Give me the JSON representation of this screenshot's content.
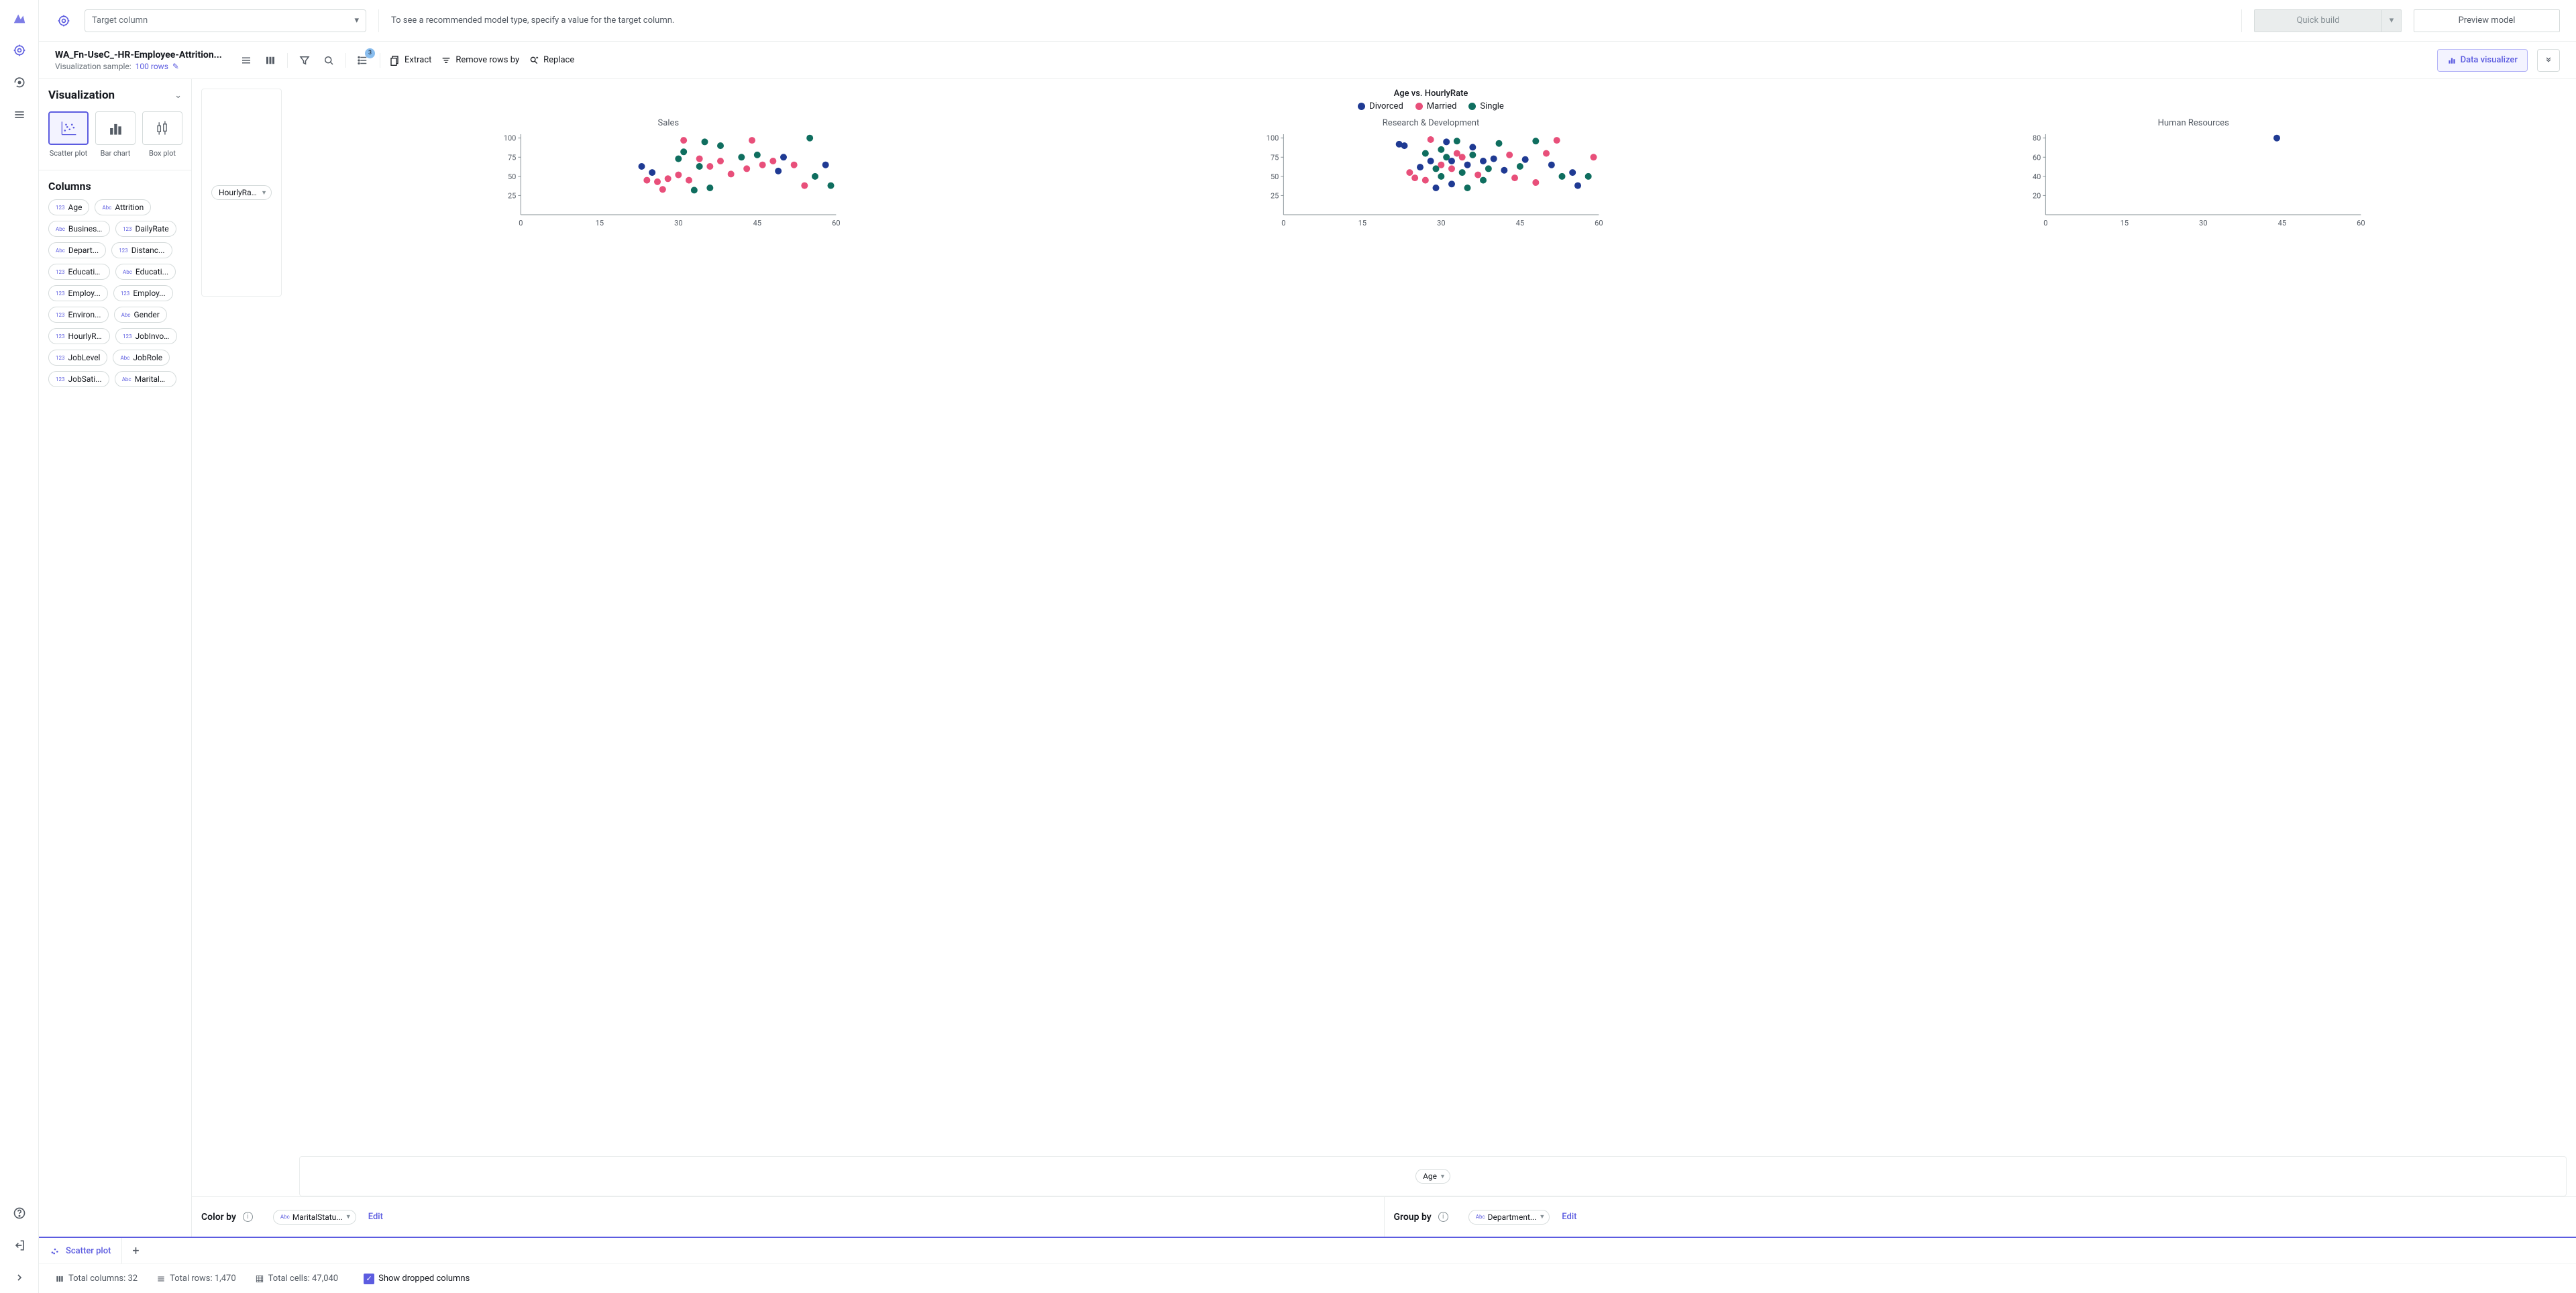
{
  "topbar": {
    "target_placeholder": "Target column",
    "hint": "To see a recommended model type, specify a value for the target column.",
    "quick_build": "Quick build",
    "preview_model": "Preview model"
  },
  "toolbar": {
    "file_title": "WA_Fn-UseC_-HR-Employee-Attrition...",
    "sample_label": "Visualization sample:",
    "sample_value": "100 rows",
    "badge": "3",
    "extract": "Extract",
    "remove_rows": "Remove rows by",
    "replace": "Replace",
    "data_visualizer": "Data visualizer"
  },
  "sidepanel": {
    "title": "Visualization",
    "viz_types": [
      {
        "label": "Scatter plot",
        "active": true
      },
      {
        "label": "Bar chart",
        "active": false
      },
      {
        "label": "Box plot",
        "active": false
      }
    ],
    "columns_title": "Columns",
    "columns": [
      {
        "type": "123",
        "name": "Age"
      },
      {
        "type": "Abc",
        "name": "Attrition"
      },
      {
        "type": "Abc",
        "name": "Busines..."
      },
      {
        "type": "123",
        "name": "DailyRate"
      },
      {
        "type": "Abc",
        "name": "Depart..."
      },
      {
        "type": "123",
        "name": "Distanc..."
      },
      {
        "type": "123",
        "name": "Education"
      },
      {
        "type": "Abc",
        "name": "Educati..."
      },
      {
        "type": "123",
        "name": "Employ..."
      },
      {
        "type": "123",
        "name": "Employ..."
      },
      {
        "type": "123",
        "name": "Environ..."
      },
      {
        "type": "Abc",
        "name": "Gender"
      },
      {
        "type": "123",
        "name": "HourlyR..."
      },
      {
        "type": "123",
        "name": "JobInvo..."
      },
      {
        "type": "123",
        "name": "JobLevel"
      },
      {
        "type": "Abc",
        "name": "JobRole"
      },
      {
        "type": "123",
        "name": "JobSati..."
      },
      {
        "type": "Abc",
        "name": "MaritalS..."
      }
    ]
  },
  "chart": {
    "title": "Age vs. HourlyRate",
    "legend": [
      {
        "name": "Divorced",
        "color": "#1f3a93"
      },
      {
        "name": "Married",
        "color": "#e84f7a"
      },
      {
        "name": "Single",
        "color": "#0f6e5f"
      }
    ],
    "y_pill": "HourlyRate...",
    "x_pill": "Age",
    "facets": [
      "Sales",
      "Research & Development",
      "Human Resources"
    ]
  },
  "chart_data": {
    "type": "scatter",
    "title": "Age vs. HourlyRate",
    "xlabel": "Age",
    "ylabel": "HourlyRate",
    "xlim": [
      0,
      60
    ],
    "ylim": [
      0,
      110
    ],
    "xticks": [
      0,
      15,
      30,
      45,
      60
    ],
    "yticks_main": [
      25,
      50,
      75,
      100
    ],
    "yticks_hr": [
      20,
      40,
      60,
      80
    ],
    "color_by": "MaritalStatus",
    "group_by": "Department",
    "colors": {
      "Divorced": "#1f3a93",
      "Married": "#e84f7a",
      "Single": "#0f6e5f"
    },
    "facets": {
      "Sales": [
        {
          "x": 23,
          "y": 63,
          "c": "Divorced"
        },
        {
          "x": 24,
          "y": 45,
          "c": "Married"
        },
        {
          "x": 25,
          "y": 55,
          "c": "Divorced"
        },
        {
          "x": 26,
          "y": 43,
          "c": "Married"
        },
        {
          "x": 27,
          "y": 33,
          "c": "Married"
        },
        {
          "x": 28,
          "y": 47,
          "c": "Married"
        },
        {
          "x": 30,
          "y": 73,
          "c": "Single"
        },
        {
          "x": 30,
          "y": 52,
          "c": "Married"
        },
        {
          "x": 31,
          "y": 97,
          "c": "Married"
        },
        {
          "x": 31,
          "y": 82,
          "c": "Single"
        },
        {
          "x": 32,
          "y": 45,
          "c": "Married"
        },
        {
          "x": 33,
          "y": 32,
          "c": "Single"
        },
        {
          "x": 34,
          "y": 73,
          "c": "Married"
        },
        {
          "x": 34,
          "y": 63,
          "c": "Single"
        },
        {
          "x": 35,
          "y": 95,
          "c": "Single"
        },
        {
          "x": 36,
          "y": 35,
          "c": "Single"
        },
        {
          "x": 36,
          "y": 63,
          "c": "Married"
        },
        {
          "x": 38,
          "y": 90,
          "c": "Single"
        },
        {
          "x": 38,
          "y": 70,
          "c": "Married"
        },
        {
          "x": 40,
          "y": 53,
          "c": "Married"
        },
        {
          "x": 42,
          "y": 75,
          "c": "Single"
        },
        {
          "x": 43,
          "y": 60,
          "c": "Married"
        },
        {
          "x": 44,
          "y": 97,
          "c": "Married"
        },
        {
          "x": 45,
          "y": 78,
          "c": "Single"
        },
        {
          "x": 46,
          "y": 65,
          "c": "Married"
        },
        {
          "x": 48,
          "y": 70,
          "c": "Married"
        },
        {
          "x": 49,
          "y": 57,
          "c": "Divorced"
        },
        {
          "x": 50,
          "y": 75,
          "c": "Divorced"
        },
        {
          "x": 52,
          "y": 65,
          "c": "Married"
        },
        {
          "x": 54,
          "y": 38,
          "c": "Married"
        },
        {
          "x": 55,
          "y": 100,
          "c": "Single"
        },
        {
          "x": 56,
          "y": 50,
          "c": "Single"
        },
        {
          "x": 58,
          "y": 65,
          "c": "Divorced"
        },
        {
          "x": 59,
          "y": 38,
          "c": "Single"
        }
      ],
      "Research & Development": [
        {
          "x": 22,
          "y": 92,
          "c": "Divorced"
        },
        {
          "x": 23,
          "y": 90,
          "c": "Divorced"
        },
        {
          "x": 24,
          "y": 55,
          "c": "Married"
        },
        {
          "x": 25,
          "y": 48,
          "c": "Married"
        },
        {
          "x": 26,
          "y": 62,
          "c": "Divorced"
        },
        {
          "x": 27,
          "y": 80,
          "c": "Single"
        },
        {
          "x": 27,
          "y": 45,
          "c": "Married"
        },
        {
          "x": 28,
          "y": 98,
          "c": "Married"
        },
        {
          "x": 28,
          "y": 70,
          "c": "Divorced"
        },
        {
          "x": 29,
          "y": 60,
          "c": "Single"
        },
        {
          "x": 29,
          "y": 35,
          "c": "Divorced"
        },
        {
          "x": 30,
          "y": 85,
          "c": "Single"
        },
        {
          "x": 30,
          "y": 65,
          "c": "Married"
        },
        {
          "x": 30,
          "y": 50,
          "c": "Single"
        },
        {
          "x": 31,
          "y": 75,
          "c": "Single"
        },
        {
          "x": 31,
          "y": 95,
          "c": "Divorced"
        },
        {
          "x": 32,
          "y": 60,
          "c": "Married"
        },
        {
          "x": 32,
          "y": 70,
          "c": "Divorced"
        },
        {
          "x": 32,
          "y": 40,
          "c": "Divorced"
        },
        {
          "x": 33,
          "y": 80,
          "c": "Married"
        },
        {
          "x": 33,
          "y": 96,
          "c": "Single"
        },
        {
          "x": 34,
          "y": 55,
          "c": "Single"
        },
        {
          "x": 34,
          "y": 75,
          "c": "Married"
        },
        {
          "x": 35,
          "y": 65,
          "c": "Divorced"
        },
        {
          "x": 35,
          "y": 35,
          "c": "Single"
        },
        {
          "x": 36,
          "y": 78,
          "c": "Single"
        },
        {
          "x": 36,
          "y": 88,
          "c": "Divorced"
        },
        {
          "x": 37,
          "y": 52,
          "c": "Married"
        },
        {
          "x": 38,
          "y": 45,
          "c": "Single"
        },
        {
          "x": 38,
          "y": 70,
          "c": "Divorced"
        },
        {
          "x": 39,
          "y": 60,
          "c": "Single"
        },
        {
          "x": 40,
          "y": 73,
          "c": "Divorced"
        },
        {
          "x": 41,
          "y": 93,
          "c": "Single"
        },
        {
          "x": 42,
          "y": 58,
          "c": "Divorced"
        },
        {
          "x": 43,
          "y": 78,
          "c": "Married"
        },
        {
          "x": 44,
          "y": 48,
          "c": "Married"
        },
        {
          "x": 45,
          "y": 63,
          "c": "Single"
        },
        {
          "x": 46,
          "y": 72,
          "c": "Divorced"
        },
        {
          "x": 48,
          "y": 96,
          "c": "Single"
        },
        {
          "x": 48,
          "y": 42,
          "c": "Married"
        },
        {
          "x": 50,
          "y": 80,
          "c": "Married"
        },
        {
          "x": 51,
          "y": 65,
          "c": "Divorced"
        },
        {
          "x": 52,
          "y": 97,
          "c": "Married"
        },
        {
          "x": 53,
          "y": 50,
          "c": "Single"
        },
        {
          "x": 55,
          "y": 55,
          "c": "Divorced"
        },
        {
          "x": 56,
          "y": 38,
          "c": "Divorced"
        },
        {
          "x": 58,
          "y": 50,
          "c": "Single"
        },
        {
          "x": 59,
          "y": 75,
          "c": "Married"
        }
      ],
      "Human Resources": [
        {
          "x": 44,
          "y": 80,
          "c": "Divorced"
        }
      ]
    }
  },
  "config": {
    "color_by_label": "Color by",
    "color_by_value": "MaritalStatu...",
    "group_by_label": "Group by",
    "group_by_value": "Department...",
    "edit": "Edit"
  },
  "tabs": {
    "active": "Scatter plot"
  },
  "status": {
    "cols": "Total columns: 32",
    "rows": "Total rows: 1,470",
    "cells": "Total cells: 47,040",
    "show_dropped": "Show dropped columns"
  }
}
